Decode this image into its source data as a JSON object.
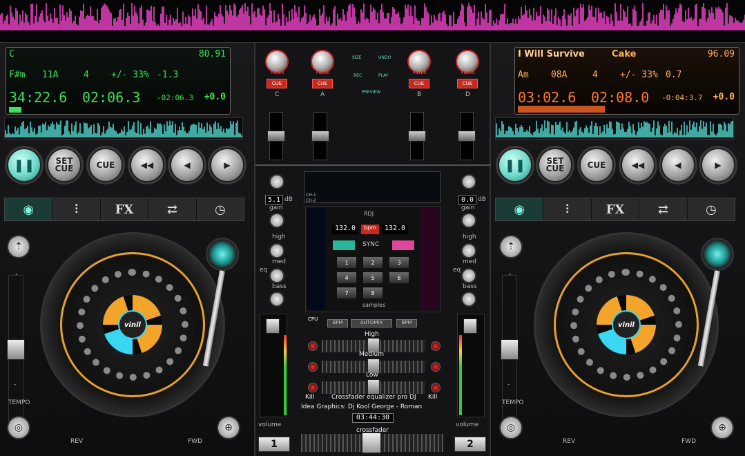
{
  "deck_a": {
    "key": "C",
    "bpm": "80.91",
    "musical_key": "F#m",
    "camelot": "11A",
    "number": "4",
    "pitch_range": "+/- 33%",
    "pitch": "-1.3",
    "elapsed": "34:22.6",
    "length": "02:06.3",
    "remaining": "-02:06.3",
    "offset": "+0.0"
  },
  "deck_b": {
    "title": "I Will Survive",
    "artist": "Cake",
    "bpm": "96.09",
    "musical_key": "Am",
    "camelot": "08A",
    "number": "4",
    "pitch_range": "+/- 33%",
    "pitch": "0.7",
    "elapsed": "03:02.6",
    "length": "02:08.0",
    "remaining": "-0:04:3.7",
    "offset": "+0.0"
  },
  "transport": {
    "set_cue": "SET\nCUE",
    "cue": "CUE"
  },
  "tabs": {
    "fx": "FX"
  },
  "deck_labels": {
    "tempo": "TEMPO",
    "rev": "REV",
    "fwd": "FWD",
    "vinyl_logo": "vinil",
    "plus": "+",
    "minus": "-"
  },
  "mixer": {
    "filter": "FILTER",
    "cue": "CUE",
    "channels": [
      "C",
      "A",
      "B",
      "D"
    ],
    "center_buttons": [
      "SIZE",
      "UNDO",
      "REC",
      "PLAY",
      "PREVIEW"
    ],
    "gain_left": "5.1",
    "gain_right": "0.0",
    "db": "dB",
    "gain": "gain",
    "eq": "eq",
    "high": "high",
    "med": "med",
    "bass": "bass",
    "ch1": "CH-1",
    "ch2": "CH-2",
    "rdj": "RDJ",
    "bpm_left": "132.0",
    "bpm_label": "bpm",
    "bpm_right": "132.0",
    "sync": "SYNC",
    "pads": [
      "1",
      "2",
      "3",
      "4",
      "5",
      "6",
      "7",
      "8"
    ],
    "samples": "samples",
    "cpu": "CPU",
    "bpm_btn": "BPM",
    "automix": "AUTOMIX",
    "eq_high": "High",
    "eq_medium": "Medium",
    "eq_low": "Low",
    "kill": "Kill",
    "eq_title": "Crossfader equalizer pro DJ",
    "credits": "Idea Graphics: Dj Kool George - Roman",
    "clock": "03:44:30",
    "crossfader": "crossfader",
    "volume": "volume",
    "deck1": "1",
    "deck2": "2",
    "meter_scale": [
      "8",
      "7",
      "6",
      "5",
      "4",
      "3",
      "2",
      "1",
      "0"
    ]
  },
  "colors": {
    "accent_teal": "#6fd9c9",
    "lcd_green": "#3fe05a",
    "lcd_orange": "#ff7a2a",
    "cue_red": "#c8281e",
    "wave_pink": "#e040c0"
  }
}
